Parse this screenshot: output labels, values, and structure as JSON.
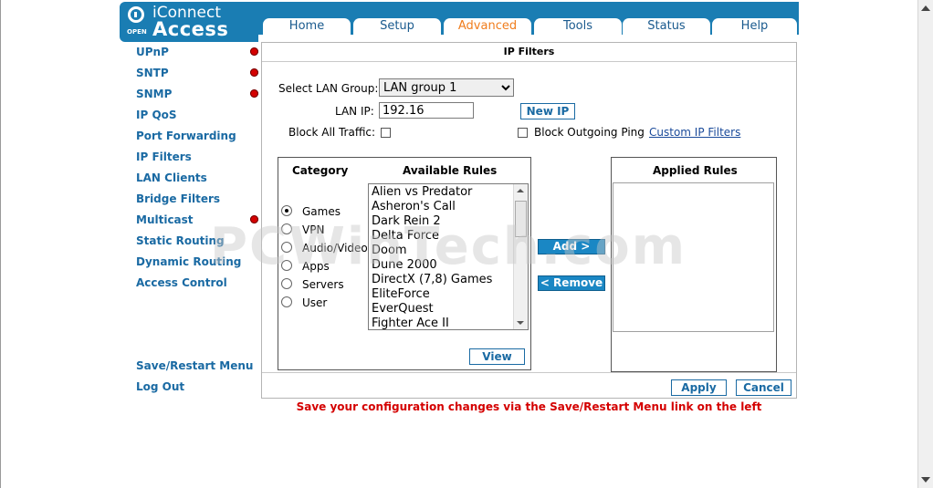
{
  "logo": {
    "brand_line1": "iConnect",
    "brand_line2": "Access",
    "badge": "OPEN"
  },
  "tabs": [
    {
      "label": "Home",
      "active": false
    },
    {
      "label": "Setup",
      "active": false
    },
    {
      "label": "Advanced",
      "active": true
    },
    {
      "label": "Tools",
      "active": false
    },
    {
      "label": "Status",
      "active": false
    },
    {
      "label": "Help",
      "active": false
    }
  ],
  "sidebar": {
    "items": [
      {
        "label": "UPnP",
        "alert": true
      },
      {
        "label": "SNTP",
        "alert": true
      },
      {
        "label": "SNMP",
        "alert": true
      },
      {
        "label": "IP QoS",
        "alert": false
      },
      {
        "label": "Port Forwarding",
        "alert": false
      },
      {
        "label": "IP Filters",
        "alert": false
      },
      {
        "label": "LAN Clients",
        "alert": false
      },
      {
        "label": "Bridge Filters",
        "alert": false
      },
      {
        "label": "Multicast",
        "alert": true
      },
      {
        "label": "Static Routing",
        "alert": false
      },
      {
        "label": "Dynamic Routing",
        "alert": false
      },
      {
        "label": "Access Control",
        "alert": false
      }
    ],
    "save_restart": "Save/Restart Menu",
    "logout": "Log Out"
  },
  "panel": {
    "title": "IP Filters",
    "lan_group_label": "Select LAN Group:",
    "lan_group_value": "LAN group 1",
    "lan_ip_label": "LAN IP:",
    "lan_ip_value": "192.16",
    "new_ip_button": "New IP",
    "block_all_label": "Block All Traffic:",
    "block_ping_label": "Block Outgoing Ping",
    "custom_filters_link": "Custom IP Filters",
    "category_header": "Category",
    "available_header": "Available Rules",
    "applied_header": "Applied Rules",
    "categories": [
      "Games",
      "VPN",
      "Audio/Video",
      "Apps",
      "Servers",
      "User"
    ],
    "selected_category": "Games",
    "available_rules": [
      "Alien vs Predator",
      "Asheron's Call",
      "Dark Rein 2",
      "Delta Force",
      "Doom",
      "Dune 2000",
      "DirectX (7,8) Games",
      "EliteForce",
      "EverQuest",
      "Fighter Ace II"
    ],
    "add_button": "Add >",
    "remove_button": "< Remove",
    "view_button": "View",
    "apply_button": "Apply",
    "cancel_button": "Cancel"
  },
  "notice": "Save your configuration changes via the Save/Restart Menu link on the left",
  "watermark": "PCWinTech.com",
  "colors": {
    "brand_blue": "#1a7db3",
    "link_blue": "#1a6aa3",
    "active_tab": "#f07d1d",
    "alert_red": "#d40000"
  }
}
